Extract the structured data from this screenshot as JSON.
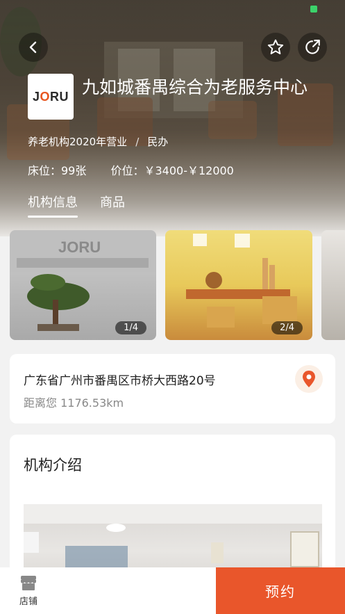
{
  "header": {
    "title": "九如城番禺综合为老服务中心",
    "logo_text": "JORU",
    "category": "养老机构2020年营业",
    "separator": "/",
    "ownership": "民办",
    "beds": "床位：99张",
    "price": "价位：￥3400-￥12000"
  },
  "tabs": [
    {
      "label": "机构信息",
      "active": true
    },
    {
      "label": "商品",
      "active": false
    }
  ],
  "gallery": [
    {
      "counter": "1/4"
    },
    {
      "counter": "2/4"
    }
  ],
  "address": {
    "text": "广东省广州市番禺区市桥大西路20号",
    "distance": "距离您 1176.53km"
  },
  "intro": {
    "title": "机构介绍"
  },
  "bottom_bar": {
    "shop_label": "店铺",
    "book_label": "预约"
  },
  "colors": {
    "accent": "#e9562b",
    "status_green": "#3cd26a"
  },
  "icons": [
    "back-icon",
    "star-icon",
    "share-icon",
    "map-pin-icon",
    "shop-icon"
  ]
}
